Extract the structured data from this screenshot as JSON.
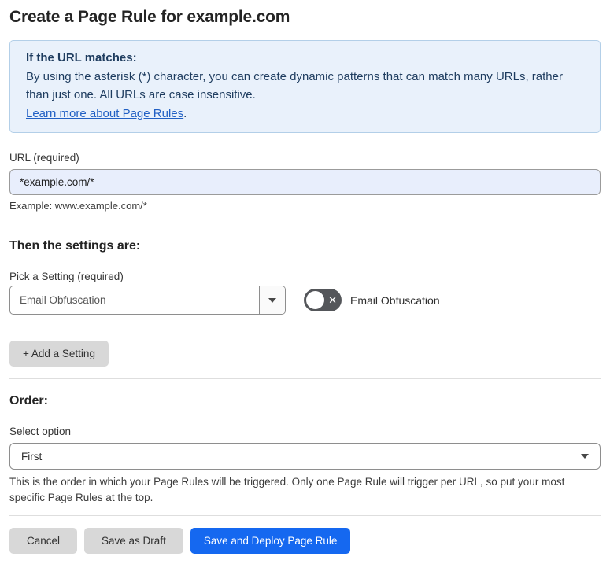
{
  "page": {
    "title": "Create a Page Rule for example.com"
  },
  "info_box": {
    "heading": "If the URL matches:",
    "body": "By using the asterisk (*) character, you can create dynamic patterns that can match many URLs, rather than just one. All URLs are case insensitive.",
    "link_label": "Learn more about Page Rules",
    "link_suffix": "."
  },
  "url_field": {
    "label": "URL (required)",
    "value": "*example.com/*",
    "helper": "Example: www.example.com/*"
  },
  "settings_section": {
    "heading": "Then the settings are:",
    "picker_label": "Pick a Setting (required)",
    "picker_value": "Email Obfuscation",
    "toggle_label": "Email Obfuscation",
    "toggle_state": "off",
    "add_setting_label": "+ Add a Setting"
  },
  "order_section": {
    "heading": "Order:",
    "select_label": "Select option",
    "select_value": "First",
    "helper": "This is the order in which your Page Rules will be triggered. Only one Page Rule will trigger per URL, so put your most specific Page Rules at the top."
  },
  "footer": {
    "cancel_label": "Cancel",
    "save_draft_label": "Save as Draft",
    "save_deploy_label": "Save and Deploy Page Rule"
  },
  "icons": {
    "toggle_off_x": "✕"
  },
  "colors": {
    "accent_blue": "#1568f0",
    "info_bg": "#e9f1fb",
    "info_border": "#b3cfe8",
    "info_text": "#1e3c5f",
    "link": "#2160c4",
    "input_bg": "#e8eefc",
    "toggle_bg": "#54565a",
    "button_gray": "#d8d8d8"
  }
}
